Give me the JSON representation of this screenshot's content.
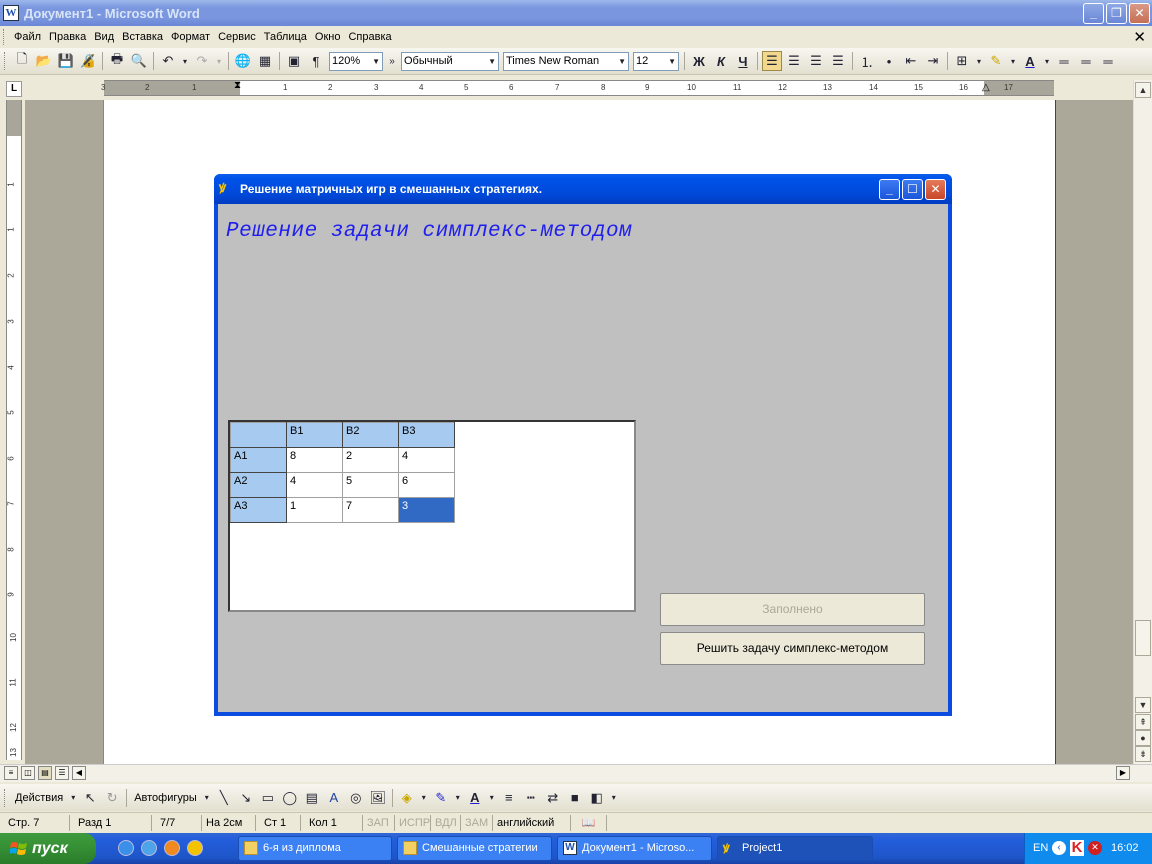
{
  "window": {
    "title": "Документ1 - Microsoft Word",
    "app_icon": "word-icon"
  },
  "menu": {
    "items": [
      "Файл",
      "Правка",
      "Вид",
      "Вставка",
      "Формат",
      "Сервис",
      "Таблица",
      "Окно",
      "Справка"
    ]
  },
  "toolbar": {
    "zoom": "120%",
    "style": "Обычный",
    "font": "Times New Roman",
    "size": "12",
    "bold": "Ж",
    "italic": "К",
    "underline": "Ч"
  },
  "ruler": {
    "corner": "L",
    "ticks": [
      "3",
      "2",
      "1",
      "1",
      "2",
      "3",
      "4",
      "5",
      "6",
      "7",
      "8",
      "9",
      "10",
      "11",
      "12",
      "13",
      "14",
      "15",
      "16",
      "17"
    ],
    "vticks": [
      "1",
      "1",
      "2",
      "3",
      "4",
      "5",
      "6",
      "7",
      "8",
      "9",
      "10",
      "11",
      "12",
      "13"
    ]
  },
  "app": {
    "title": "Решение матричных игр в смешанных стратегиях.",
    "heading": "Решение задачи симплекс-методом",
    "grid": {
      "columns": [
        "",
        "B1",
        "B2",
        "B3"
      ],
      "rows": [
        {
          "label": "A1",
          "values": [
            "8",
            "2",
            "4"
          ]
        },
        {
          "label": "A2",
          "values": [
            "4",
            "5",
            "6"
          ]
        },
        {
          "label": "A3",
          "values": [
            "1",
            "7",
            "3"
          ]
        }
      ],
      "selected": "A3-B3"
    },
    "buttons": {
      "filled": "Заполнено",
      "solve": "Решить задачу симплекс-методом"
    }
  },
  "drawbar": {
    "actions": "Действия",
    "autoshapes": "Автофигуры"
  },
  "status": {
    "page": "Стр. 7",
    "section": "Разд 1",
    "pages": "7/7",
    "at": "На 2см",
    "line": "Ст 1",
    "col": "Кол 1",
    "rec": "ЗАП",
    "trk": "ИСПР",
    "ext": "ВДЛ",
    "ovr": "ЗАМ",
    "lang": "английский"
  },
  "taskbar": {
    "start": "пуск",
    "tasks": [
      {
        "label": "6-я из диплома",
        "icon": "folder-icon",
        "active": false
      },
      {
        "label": "Смешанные стратегии",
        "icon": "folder-icon",
        "active": false
      },
      {
        "label": "Документ1 - Microso...",
        "icon": "word-icon",
        "active": false
      },
      {
        "label": "Project1",
        "icon": "delphi-icon",
        "active": true
      }
    ],
    "lang": "EN",
    "clock": "16:02"
  }
}
